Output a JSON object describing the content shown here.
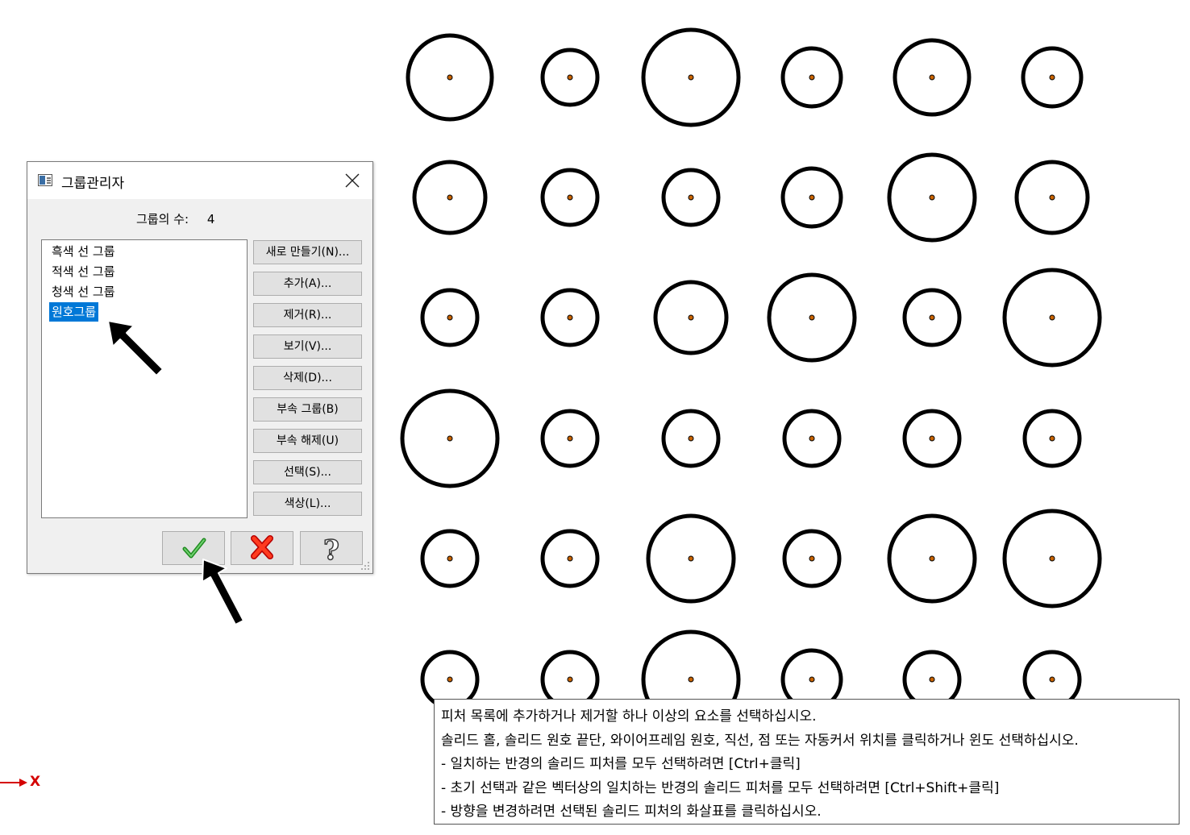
{
  "dialog": {
    "title": "그룹관리자",
    "count_label": "그룹의 수:",
    "count_value": "4",
    "groups": [
      "흑색 선 그룹",
      "적색 선 그룹",
      "청색 선 그룹",
      "원호그룹"
    ],
    "selected_group": "원호그룹",
    "side_buttons": [
      "새로 만들기(N)...",
      "추가(A)...",
      "제거(R)...",
      "보기(V)...",
      "삭제(D)...",
      "부속 그룹(B)",
      "부속 해제(U)",
      "선택(S)...",
      "색상(L)..."
    ],
    "ok_icon": "checkmark-icon",
    "cancel_icon": "red-x-icon",
    "help_icon": "question-mark-icon",
    "close_icon": "close-icon"
  },
  "message": {
    "lines": [
      "피처 목록에 추가하거나 제거할 하나 이상의 요소를 선택하십시오.",
      "솔리드 홀, 솔리드 원호 끝단, 와이어프레임 원호, 직선, 점 또는 자동커서 위치를 클릭하거나 윈도 선택하십시오.",
      "- 일치하는 반경의 솔리드 피처를 모두 선택하려면 [Ctrl+클릭]",
      "- 초기 선택과 같은 벡터상의 일치하는 반경의 솔리드 피처를 모두 선택하려면 [Ctrl+Shift+클릭]",
      "- 방향을 변경하려면 선택된 솔리드 피처의 화살표를 클릭하십시오."
    ]
  },
  "axis": {
    "x_label": "X"
  },
  "colors": {
    "selection": "#0078d7",
    "circle": "#000000",
    "center_point": "#c86400",
    "axis": "#d40000"
  }
}
